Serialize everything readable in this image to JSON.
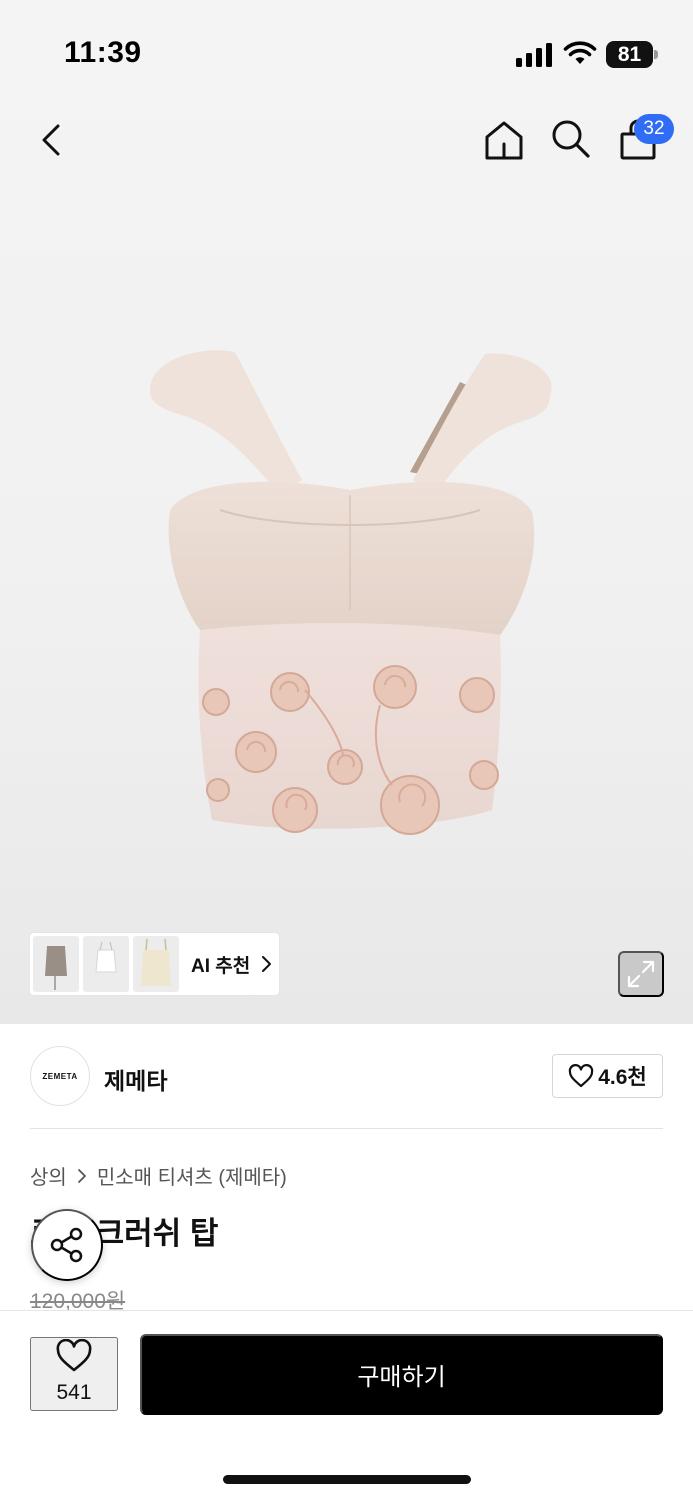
{
  "status_bar": {
    "time": "11:39",
    "battery": "81"
  },
  "header": {
    "back_icon": "chevron-left-icon",
    "home_icon": "home-icon",
    "search_icon": "search-icon",
    "cart_icon": "shopping-bag-icon",
    "cart_badge": "32",
    "badge_color": "#2f6df6"
  },
  "gallery": {
    "image_subject": "pink-sleeveless-rosette-top",
    "ai_recommend_label": "AI 추천",
    "expand_icon": "expand-icon"
  },
  "brand": {
    "logo_text": "ZEMETA",
    "name": "제메타",
    "likes": "4.6천"
  },
  "product": {
    "breadcrumb": [
      "상의",
      "민소매 티셔츠 (제메타)"
    ],
    "title": "로즈 크러쉬 탑",
    "original_price": "120,000원",
    "share_icon": "share-icon"
  },
  "bottom_bar": {
    "wish_count": "541",
    "buy_label": "구매하기",
    "buy_color": "#000000"
  }
}
